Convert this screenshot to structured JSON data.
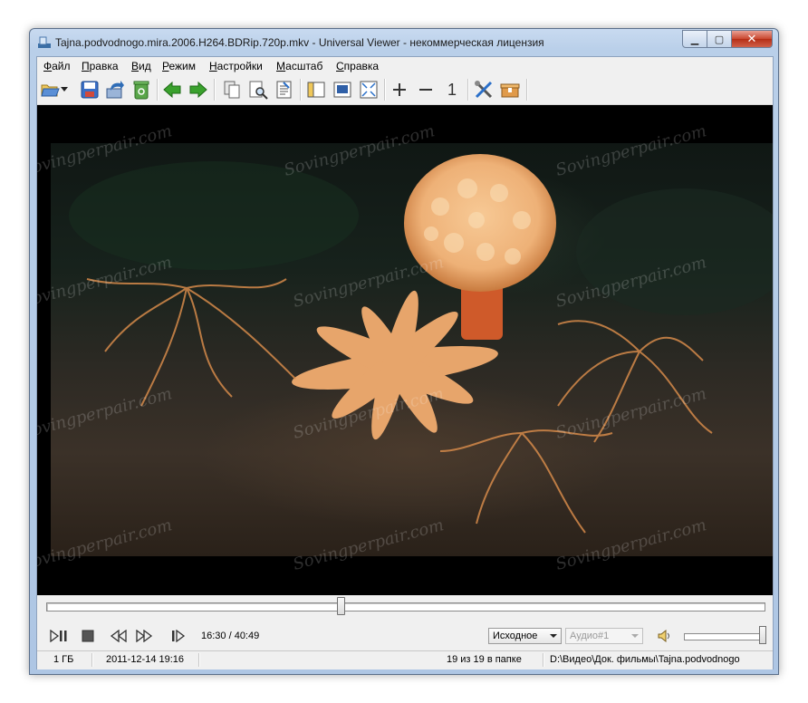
{
  "window": {
    "title": "Tajna.podvodnogo.mira.2006.H264.BDRip.720p.mkv - Universal Viewer - некоммерческая лицензия",
    "minimize": "▁",
    "maximize": "▢",
    "close": "✕"
  },
  "menu": [
    {
      "u": "Ф",
      "rest": "айл"
    },
    {
      "u": "П",
      "rest": "равка"
    },
    {
      "u": "В",
      "rest": "ид"
    },
    {
      "u": "Р",
      "rest": "ежим"
    },
    {
      "u": "Н",
      "rest": "астройки"
    },
    {
      "u": "М",
      "rest": "асштаб"
    },
    {
      "u": "С",
      "rest": "правка"
    }
  ],
  "toolbar": {
    "icons": [
      "open-folder-icon",
      "dropdown-arrow-icon",
      "save-icon",
      "export-icon",
      "recycle-icon",
      "back-arrow-icon",
      "forward-arrow-icon",
      "copy-icon",
      "find-icon",
      "text-mode-icon",
      "panel-icon",
      "fullscreen-window-icon",
      "fit-icon",
      "zoom-in-icon",
      "zoom-out-icon",
      "actual-size-icon",
      "tools-icon",
      "plugin-box-icon"
    ],
    "zoom_one_label": "1"
  },
  "watermark_text": "Sovingperpair.com",
  "player": {
    "position_fraction": 0.41,
    "time_text": "16:30 / 40:49",
    "mode_select": "Исходное",
    "audio_select": "Аудио#1",
    "volume_fraction": 0.98
  },
  "status": {
    "size": "1 ГБ",
    "datetime": "2011-12-14 19:16",
    "count": "19 из 19 в папке",
    "path": "D:\\Видео\\Док. фильмы\\Tajna.podvodnogo"
  },
  "colors": {
    "accent_green": "#3aa12d",
    "accent_blue": "#2a6fc9",
    "orange": "#e09a4a"
  }
}
